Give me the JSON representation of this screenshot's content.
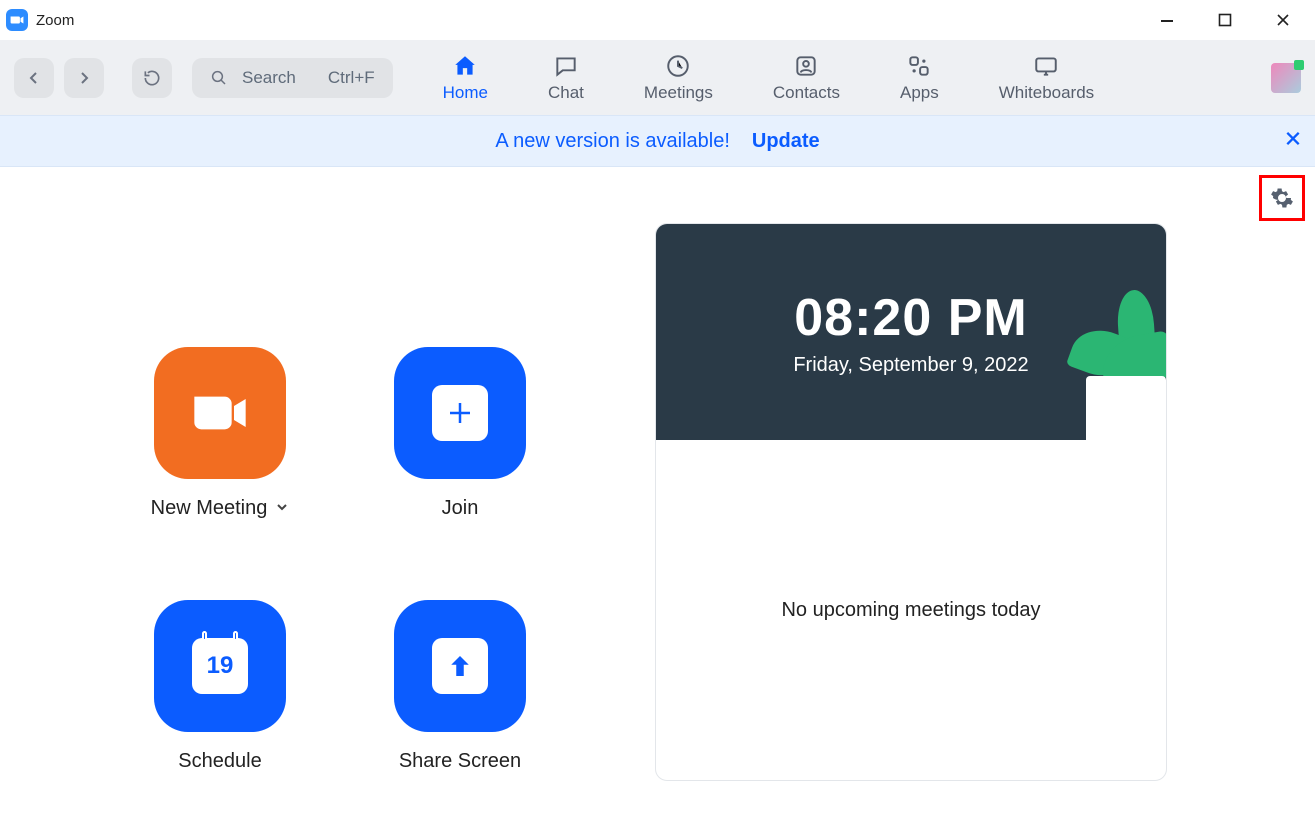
{
  "window": {
    "title": "Zoom"
  },
  "toolbar": {
    "search_label": "Search",
    "search_shortcut": "Ctrl+F",
    "tabs": [
      {
        "label": "Home",
        "active": true
      },
      {
        "label": "Chat",
        "active": false
      },
      {
        "label": "Meetings",
        "active": false
      },
      {
        "label": "Contacts",
        "active": false
      },
      {
        "label": "Apps",
        "active": false
      },
      {
        "label": "Whiteboards",
        "active": false
      }
    ]
  },
  "banner": {
    "message": "A new version is available!",
    "action": "Update"
  },
  "home": {
    "actions": {
      "new_meeting": "New Meeting",
      "join": "Join",
      "schedule": "Schedule",
      "schedule_day": "19",
      "share_screen": "Share Screen"
    },
    "clock": {
      "time": "08:20 PM",
      "date": "Friday, September 9, 2022"
    },
    "upcoming_empty": "No upcoming meetings today"
  }
}
